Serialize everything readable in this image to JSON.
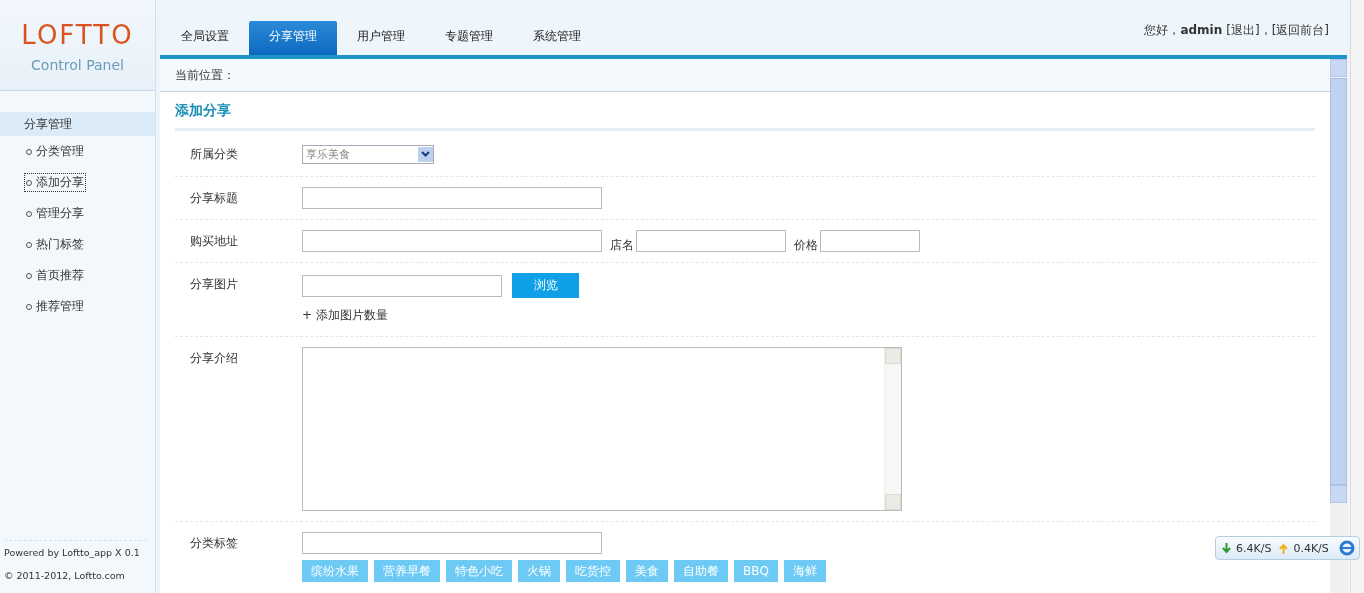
{
  "logo": {
    "name": "LOFTTO",
    "subtitle": "Control Panel"
  },
  "nav": [
    {
      "label": "全局设置",
      "selected": false
    },
    {
      "label": "分享管理",
      "selected": true
    },
    {
      "label": "用户管理",
      "selected": false
    },
    {
      "label": "专题管理",
      "selected": false
    },
    {
      "label": "系统管理",
      "selected": false
    }
  ],
  "user_bar": {
    "greeting": "您好，",
    "username": "admin",
    "logout": "[退出]",
    "separator": "，",
    "frontend": "[返回前台]"
  },
  "breadcrumb": "当前位置：",
  "sidebar": {
    "heading": "分享管理",
    "items": [
      {
        "label": "分类管理",
        "selected": false
      },
      {
        "label": "添加分享",
        "selected": true
      },
      {
        "label": "管理分享",
        "selected": false
      },
      {
        "label": "热门标签",
        "selected": false
      },
      {
        "label": "首页推荐",
        "selected": false
      },
      {
        "label": "推荐管理",
        "selected": false
      }
    ]
  },
  "footer": {
    "powered": "Powered by Loftto_app X 0.1",
    "copyright": "© 2011-2012, Loftto.com"
  },
  "form": {
    "title": "添加分享",
    "rows": [
      {
        "kind": "select",
        "label": "所属分类",
        "value": "享乐美食"
      },
      {
        "kind": "text",
        "label": "分享标题"
      },
      {
        "kind": "multi",
        "label": "购买地址",
        "extras": [
          {
            "label": "店名"
          },
          {
            "label": "价格"
          }
        ]
      },
      {
        "kind": "file",
        "label": "分享图片",
        "button": "浏览",
        "link": "+ 添加图片数量"
      },
      {
        "kind": "textarea",
        "label": "分享介绍"
      },
      {
        "kind": "tags",
        "label": "分类标签",
        "tags": [
          "缤纷水果",
          "营养早餐",
          "特色小吃",
          "火锅",
          "吃货控",
          "美食",
          "自助餐",
          "BBQ",
          "海鲜"
        ]
      }
    ]
  },
  "speed_meter": {
    "down": "6.4K/S",
    "up": "0.4K/S"
  }
}
